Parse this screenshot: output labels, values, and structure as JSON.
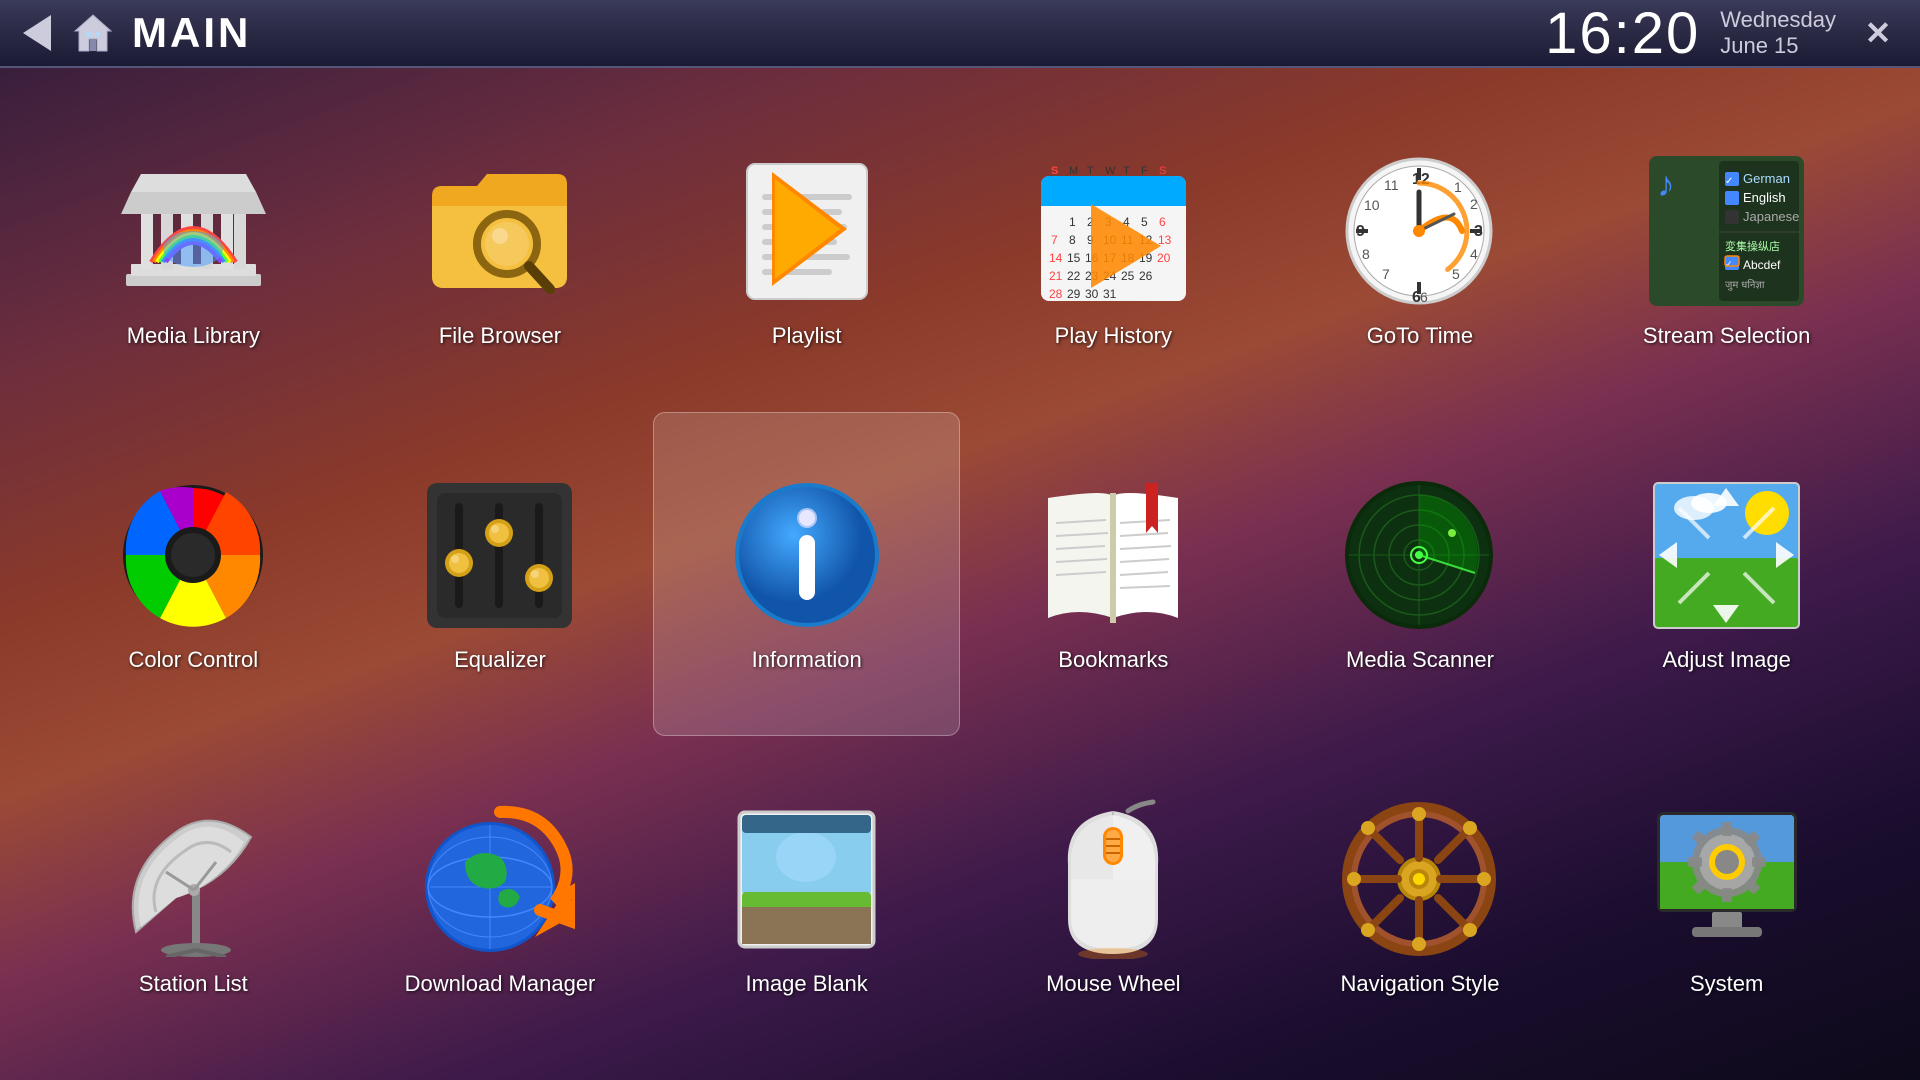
{
  "header": {
    "title": "MAIN",
    "time": "16:20",
    "day": "Wednesday",
    "date": "June 15",
    "back_label": "back",
    "home_label": "home",
    "close_label": "✕"
  },
  "apps": [
    {
      "id": "media-library",
      "label": "Media Library",
      "row": 1,
      "col": 1,
      "active": false
    },
    {
      "id": "file-browser",
      "label": "File Browser",
      "row": 1,
      "col": 2,
      "active": false
    },
    {
      "id": "playlist",
      "label": "Playlist",
      "row": 1,
      "col": 3,
      "active": false
    },
    {
      "id": "play-history",
      "label": "Play History",
      "row": 1,
      "col": 4,
      "active": false
    },
    {
      "id": "goto-time",
      "label": "GoTo Time",
      "row": 1,
      "col": 5,
      "active": false
    },
    {
      "id": "stream-selection",
      "label": "Stream Selection",
      "row": 1,
      "col": 6,
      "active": false
    },
    {
      "id": "color-control",
      "label": "Color Control",
      "row": 2,
      "col": 1,
      "active": false
    },
    {
      "id": "equalizer",
      "label": "Equalizer",
      "row": 2,
      "col": 2,
      "active": false
    },
    {
      "id": "information",
      "label": "Information",
      "row": 2,
      "col": 3,
      "active": true
    },
    {
      "id": "bookmarks",
      "label": "Bookmarks",
      "row": 2,
      "col": 4,
      "active": false
    },
    {
      "id": "media-scanner",
      "label": "Media Scanner",
      "row": 2,
      "col": 5,
      "active": false
    },
    {
      "id": "adjust-image",
      "label": "Adjust Image",
      "row": 2,
      "col": 6,
      "active": false
    },
    {
      "id": "station-list",
      "label": "Station List",
      "row": 3,
      "col": 1,
      "active": false
    },
    {
      "id": "download-manager",
      "label": "Download Manager",
      "row": 3,
      "col": 2,
      "active": false
    },
    {
      "id": "image-blank",
      "label": "Image Blank",
      "row": 3,
      "col": 3,
      "active": false
    },
    {
      "id": "mouse-wheel",
      "label": "Mouse Wheel",
      "row": 3,
      "col": 4,
      "active": false
    },
    {
      "id": "navigation-style",
      "label": "Navigation Style",
      "row": 3,
      "col": 5,
      "active": false
    },
    {
      "id": "system",
      "label": "System",
      "row": 3,
      "col": 6,
      "active": false
    }
  ]
}
